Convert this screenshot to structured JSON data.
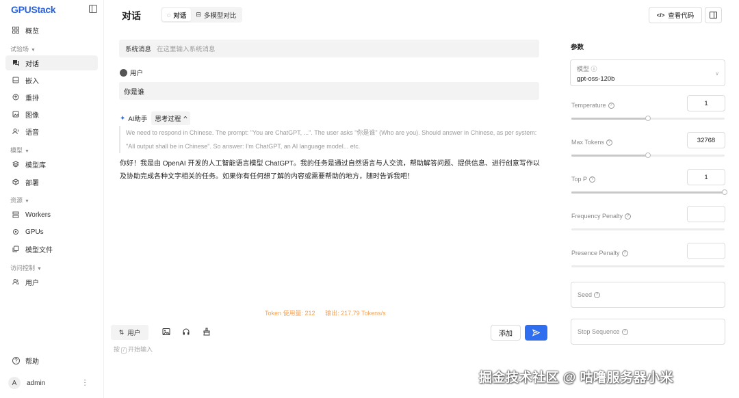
{
  "app": {
    "logo": "GPUStack"
  },
  "sidebar": {
    "overview": "概览",
    "groups": {
      "playground": "试验场",
      "models": "模型",
      "resources": "资源",
      "access": "访问控制"
    },
    "items": {
      "chat": "对话",
      "embed": "嵌入",
      "rerank": "重排",
      "image": "图像",
      "audio": "语音",
      "model_catalog": "模型库",
      "deploy": "部署",
      "workers": "Workers",
      "gpus": "GPUs",
      "model_files": "模型文件",
      "users": "用户"
    },
    "help": "帮助",
    "user": {
      "avatar_letter": "A",
      "name": "admin"
    }
  },
  "header": {
    "title": "对话",
    "tabs": {
      "chat": "对话",
      "compare": "多模型对比"
    },
    "view_code": "查看代码"
  },
  "chat": {
    "system_label": "系统消息",
    "system_placeholder": "在这里输入系统消息",
    "user_role": "用户",
    "user_message": "你是谁",
    "assistant_role": "AI助手",
    "thinking_label": "思考过程",
    "thinking_text": "We need to respond in Chinese. The prompt: \"You are ChatGPT, ...\". The user asks \"你是谁\" (Who are you). Should answer in Chinese, as per system: \"All output shall be in Chinese\". So answer: I'm ChatGPT, an AI language model... etc.",
    "answer_text": "你好！我是由 OpenAI 开发的人工智能语言模型 ChatGPT。我的任务是通过自然语言与人交流，帮助解答问题、提供信息、进行创意写作以及协助完成各种文字相关的任务。如果你有任何想了解的内容或需要帮助的地方，随时告诉我吧！",
    "token_usage": "Token 使用量: 212",
    "output_rate": "输出: 217.79 Tokens/s"
  },
  "composer": {
    "role": "用户",
    "add_label": "添加",
    "placeholder_prefix": "按",
    "placeholder_key": "/",
    "placeholder_suffix": "开始输入"
  },
  "params": {
    "title": "参数",
    "model_label": "模型",
    "model_value": "gpt-oss-120b",
    "temperature": {
      "label": "Temperature",
      "value": "1",
      "fraction": 0.5
    },
    "max_tokens": {
      "label": "Max Tokens",
      "value": "32768",
      "fraction": 0.5
    },
    "top_p": {
      "label": "Top P",
      "value": "1",
      "fraction": 1.0
    },
    "frequency_penalty": {
      "label": "Frequency Penalty",
      "value": ""
    },
    "presence_penalty": {
      "label": "Presence Penalty",
      "value": ""
    },
    "seed": {
      "label": "Seed"
    },
    "stop_sequence": {
      "label": "Stop Sequence"
    }
  },
  "colors": {
    "accent": "#2f6fef",
    "token_info": "#f0a35a",
    "logo": "#2a60d8"
  },
  "watermark": "掘金技术社区 @ 咕噜服务器小米"
}
